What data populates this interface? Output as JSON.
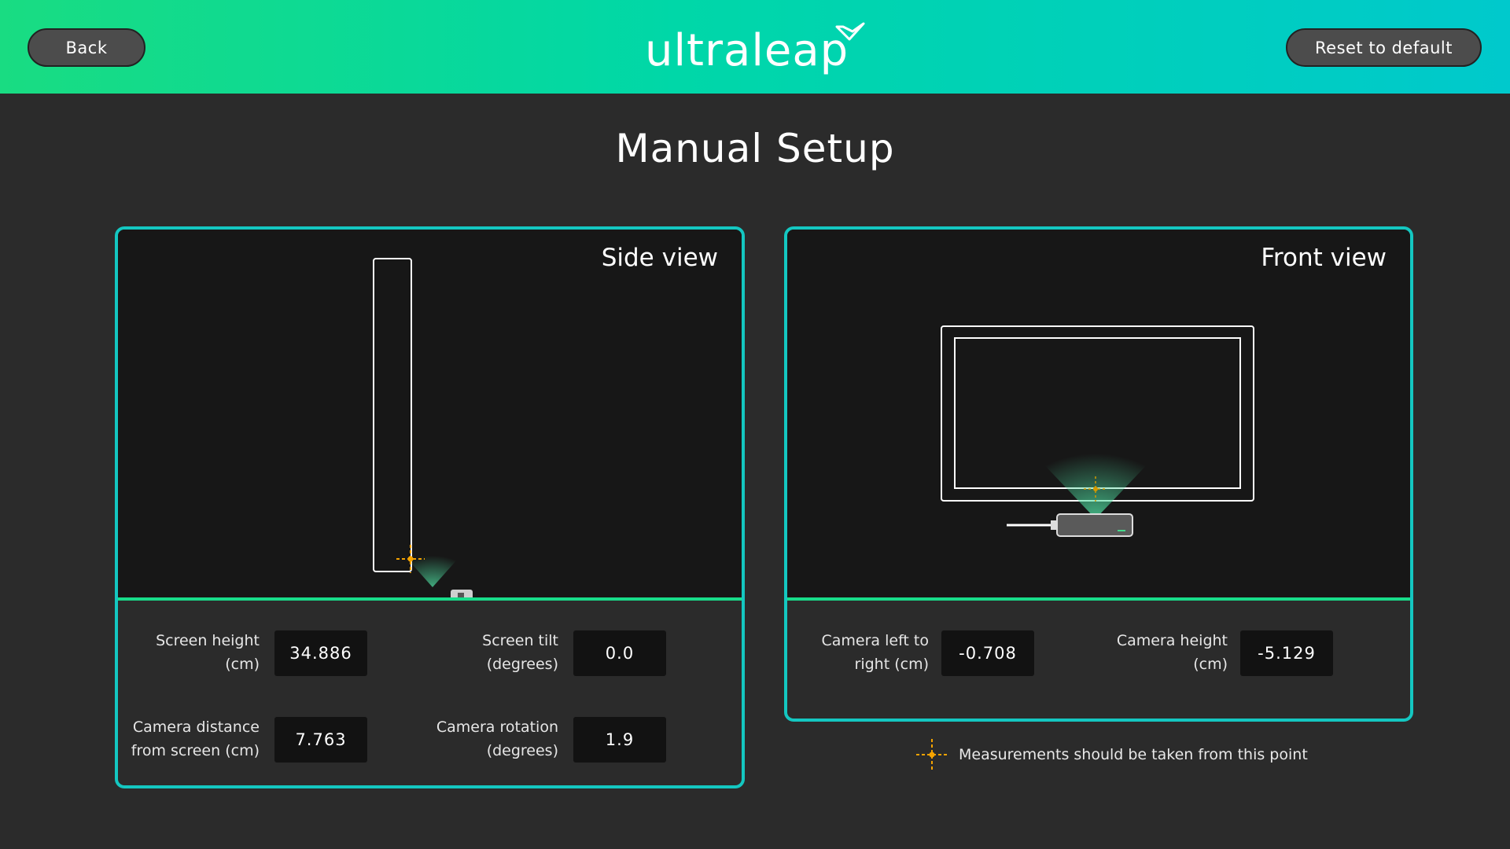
{
  "header": {
    "back_label": "Back",
    "reset_label": "Reset to default",
    "logo_text": "ultraleap"
  },
  "page": {
    "title": "Manual Setup"
  },
  "side_view": {
    "title": "Side view",
    "fields": {
      "screen_height": {
        "label_line1": "Screen height",
        "label_line2": "(cm)",
        "value": "34.886"
      },
      "screen_tilt": {
        "label_line1": "Screen tilt",
        "label_line2": "(degrees)",
        "value": "0.0"
      },
      "camera_distance": {
        "label_line1": "Camera distance",
        "label_line2": "from screen (cm)",
        "value": "7.763"
      },
      "camera_rotation": {
        "label_line1": "Camera rotation",
        "label_line2": "(degrees)",
        "value": "1.9"
      }
    }
  },
  "front_view": {
    "title": "Front view",
    "fields": {
      "camera_left_right": {
        "label_line1": "Camera left to",
        "label_line2": "right (cm)",
        "value": "-0.708"
      },
      "camera_height": {
        "label_line1": "Camera height",
        "label_line2": "(cm)",
        "value": "-5.129"
      }
    }
  },
  "legend": {
    "text": "Measurements should be taken from this point"
  },
  "colors": {
    "header_gradient_start": "#19dc82",
    "header_gradient_end": "#00c9cc",
    "panel_border": "#14c7c1",
    "viewport_divider": "#18dc8a",
    "marker": "#f5a300"
  },
  "icons": [
    "crosshair-marker-icon",
    "logo-swoosh-icon",
    "camera-device-icon"
  ]
}
